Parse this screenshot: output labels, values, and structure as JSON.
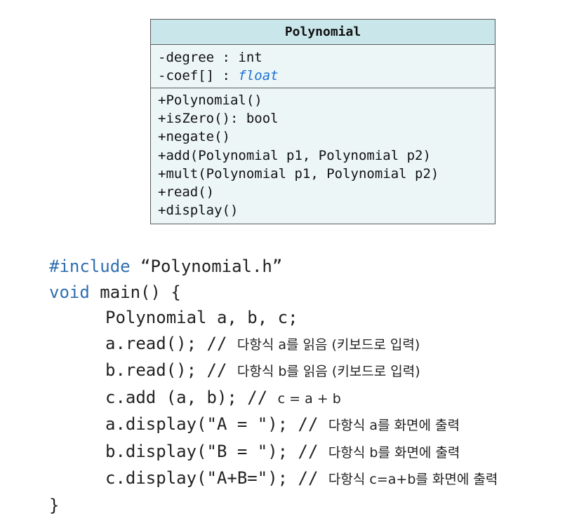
{
  "uml": {
    "class_name": "Polynomial",
    "attributes": [
      {
        "name": "-degree : ",
        "type": "int"
      },
      {
        "name": "-coef[] : ",
        "type": "float"
      }
    ],
    "methods": [
      "+Polynomial()",
      "+isZero(): bool",
      "+negate()",
      "+add(Polynomial p1, Polynomial p2)",
      "+mult(Polynomial p1, Polynomial p2)",
      "+read()",
      "+display()"
    ]
  },
  "code": {
    "include_kw": "#include",
    "include_file": " “Polynomial.h”",
    "void_kw": "void",
    "main_sig": " main() {",
    "decl": "Polynomial a, b, c;",
    "stmts": [
      {
        "code": "a.read(); ",
        "slashes": "// ",
        "comment": "다항식 a를 읽음 (키보드로 입력)"
      },
      {
        "code": "b.read(); ",
        "slashes": "// ",
        "comment": "다항식 b를 읽음 (키보드로 입력)"
      },
      {
        "code": "c.add (a, b); ",
        "slashes": "// ",
        "comment": "c = a + b"
      },
      {
        "code": "a.display(\"A = \"); ",
        "slashes": "// ",
        "comment": "다항식 a를 화면에 출력"
      },
      {
        "code": "b.display(\"B = \"); ",
        "slashes": "// ",
        "comment": "다항식 b를 화면에 출력"
      },
      {
        "code": "c.display(\"A+B=\"); ",
        "slashes": "// ",
        "comment": "다항식 c=a+b를 화면에 출력"
      }
    ],
    "close_brace": "}"
  }
}
